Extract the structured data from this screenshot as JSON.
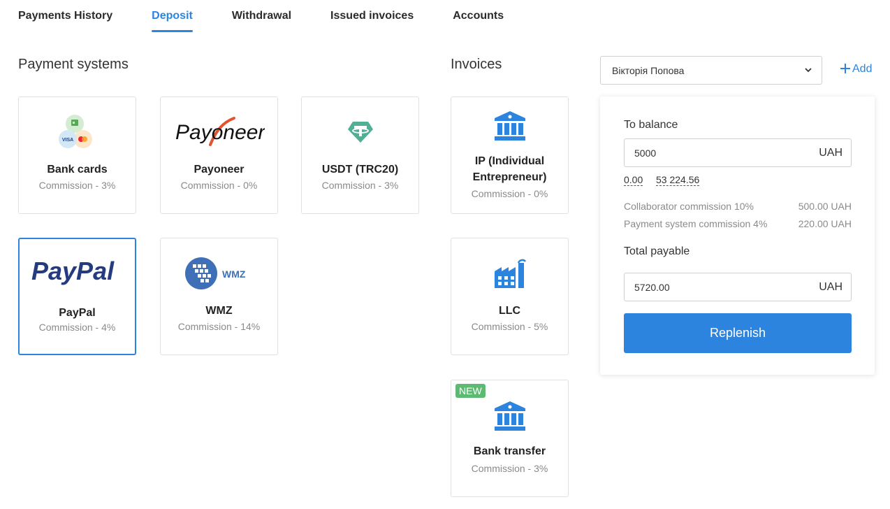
{
  "tabs": [
    {
      "label": "Payments History",
      "active": false
    },
    {
      "label": "Deposit",
      "active": true
    },
    {
      "label": "Withdrawal",
      "active": false
    },
    {
      "label": "Issued invoices",
      "active": false
    },
    {
      "label": "Accounts",
      "active": false
    }
  ],
  "payment_systems": {
    "title": "Payment systems",
    "items": [
      {
        "name": "Bank cards",
        "commission": "Commission - 3%",
        "icon": "bank-cards-icon"
      },
      {
        "name": "Payoneer",
        "commission": "Commission - 0%",
        "icon": "payoneer-logo",
        "logo_text": "Payoneer"
      },
      {
        "name": "USDT (TRC20)",
        "commission": "Commission - 3%",
        "icon": "tether-icon"
      },
      {
        "name": "PayPal",
        "commission": "Commission - 4%",
        "icon": "paypal-logo",
        "logo_text": "PayPal",
        "selected": true
      },
      {
        "name": "WMZ",
        "commission": "Commission - 14%",
        "icon": "webmoney-icon",
        "logo_text": "WMZ"
      }
    ]
  },
  "invoices": {
    "title": "Invoices",
    "items": [
      {
        "name": "IP (Individual Entrepreneur)",
        "commission": "Commission - 0%",
        "icon": "bank-building-icon"
      },
      {
        "name": "LLC",
        "commission": "Commission - 5%",
        "icon": "factory-icon"
      },
      {
        "name": "Bank transfer",
        "commission": "Commission - 3%",
        "icon": "bank-building-icon",
        "badge": "NEW"
      }
    ]
  },
  "account_select": {
    "value": "Вікторія Попова"
  },
  "add_label": "Add",
  "panel": {
    "to_balance_label": "To balance",
    "amount": "5000",
    "currency": "UAH",
    "quick_amounts": [
      "0.00",
      "53 224.56"
    ],
    "fees": [
      {
        "label": "Collaborator commission 10%",
        "value": "500.00 UAH"
      },
      {
        "label": "Payment system commission 4%",
        "value": "220.00 UAH"
      }
    ],
    "total_label": "Total payable",
    "total": "5720.00",
    "total_currency": "UAH",
    "button_label": "Replenish"
  },
  "colors": {
    "accent": "#2c84df",
    "badge": "#5cba73",
    "paypal_dark": "#253b80",
    "paypal_light": "#179bd7",
    "tether": "#50af95"
  }
}
